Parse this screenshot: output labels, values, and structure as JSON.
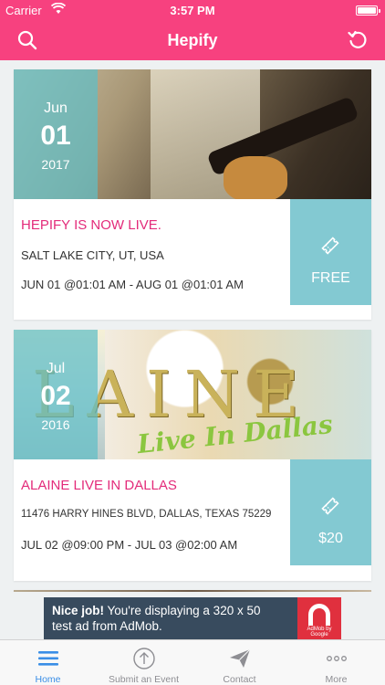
{
  "status": {
    "carrier": "Carrier",
    "time": "3:57 PM"
  },
  "nav": {
    "title": "Hepify"
  },
  "events": [
    {
      "month": "Jun",
      "day": "01",
      "year": "2017",
      "title": "HEPIFY IS NOW LIVE.",
      "location": "SALT LAKE CITY, UT, USA",
      "dates": "JUN 01 @01:01 AM - AUG 01 @01:01 AM",
      "price": "FREE"
    },
    {
      "month": "Jul",
      "day": "02",
      "year": "2016",
      "title": "ALAINE LIVE IN DALLAS",
      "location": "11476 HARRY HINES BLVD, DALLAS, TEXAS 75229",
      "dates": "JUL 02 @09:00 PM - JUL 03 @02:00 AM",
      "price": "$20",
      "image_text": "LAINE",
      "image_script": "Live In Dallas"
    }
  ],
  "ad": {
    "bold": "Nice job!",
    "text": " You're displaying a 320 x 50 test ad from AdMob.",
    "badge": "AdMob by Google"
  },
  "tabs": [
    {
      "label": "Home",
      "active": true
    },
    {
      "label": "Submit an Event"
    },
    {
      "label": "Contact"
    },
    {
      "label": "More"
    }
  ],
  "colors": {
    "primary": "#f7417f",
    "accent": "#e32b7a",
    "teal": "#83c9d2",
    "tab_active": "#3a8ee6"
  }
}
